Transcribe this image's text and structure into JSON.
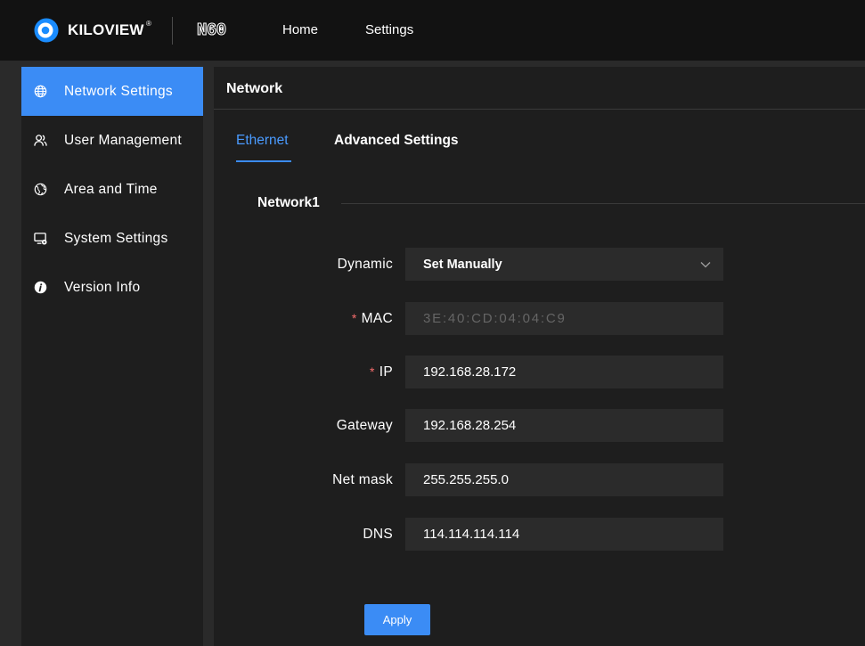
{
  "colors": {
    "accent": "#3b8cf5",
    "accent_text": "#4a9bff",
    "header_bg": "#121212",
    "frame_bg": "#2a2a2a",
    "panel_bg": "#1e1e1e",
    "input_bg": "#2b2b2b",
    "required": "#f56c6c",
    "muted_text": "#656565"
  },
  "header": {
    "logo_icon": "kiloview-logo-icon",
    "brand": "KILOVIEW",
    "brand_mark": "®",
    "model": "N60",
    "nav": [
      {
        "label": "Home"
      },
      {
        "label": "Settings"
      }
    ]
  },
  "sidebar": {
    "items": [
      {
        "label": "Network Settings",
        "icon": "globe-icon",
        "active": true
      },
      {
        "label": "User Management",
        "icon": "users-icon",
        "active": false
      },
      {
        "label": "Area and Time",
        "icon": "world-time-icon",
        "active": false
      },
      {
        "label": "System Settings",
        "icon": "monitor-settings-icon",
        "active": false
      },
      {
        "label": "Version Info",
        "icon": "info-icon",
        "active": false
      }
    ]
  },
  "main": {
    "title": "Network",
    "tabs": [
      {
        "label": "Ethernet",
        "active": true
      },
      {
        "label": "Advanced Settings",
        "active": false
      }
    ],
    "section_title": "Network1",
    "form": {
      "required_mark": "*",
      "dynamic": {
        "label": "Dynamic",
        "value": "Set Manually"
      },
      "mac": {
        "label": "MAC",
        "value": "3E:40:CD:04:04:C9",
        "required": true,
        "disabled": true
      },
      "ip": {
        "label": "IP",
        "value": "192.168.28.172",
        "required": true
      },
      "gateway": {
        "label": "Gateway",
        "value": "192.168.28.254"
      },
      "net_mask": {
        "label": "Net mask",
        "value": "255.255.255.0"
      },
      "dns": {
        "label": "DNS",
        "value": "114.114.114.114"
      }
    },
    "apply_label": "Apply"
  }
}
